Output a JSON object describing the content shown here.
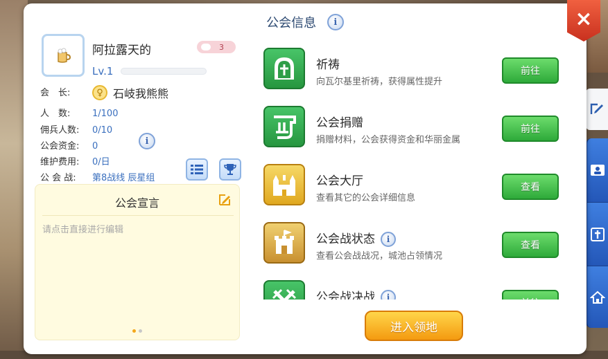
{
  "panel": {
    "title": "公会信息",
    "close_icon": "×"
  },
  "guild": {
    "name": "阿拉露天的",
    "badge_count": "3",
    "level": "Lv.1",
    "level_progress": 0.0
  },
  "info": {
    "leader_label": "会　长:",
    "leader_name": "石岐我熊熊",
    "members_label": "人　数:",
    "members_value": "1/100",
    "mercenary_label": "佣兵人数:",
    "mercenary_value": "0/10",
    "funds_label": "公会资金:",
    "funds_value": "0",
    "upkeep_label": "维护费用:",
    "upkeep_value": "0/日",
    "war_label": "公 会 战:",
    "war_value": "第8战线 辰星组"
  },
  "declaration": {
    "title": "公会宣言",
    "placeholder": "请点击直接进行编辑",
    "page_dots": 2,
    "active_dot": 0
  },
  "items": [
    {
      "name": "祈祷",
      "desc": "向瓦尔基里祈祷，获得属性提升",
      "button": "前往",
      "icon": "prayer-icon",
      "has_info": false
    },
    {
      "name": "公会捐赠",
      "desc": "捐赠材料，公会获得资金和华丽金属",
      "button": "前往",
      "icon": "donation-icon",
      "has_info": false
    },
    {
      "name": "公会大厅",
      "desc": "查看其它的公会详细信息",
      "button": "查看",
      "icon": "castle-icon",
      "has_info": false
    },
    {
      "name": "公会战状态",
      "desc": "查看公会战战况，城池占领情况",
      "button": "查看",
      "icon": "fortress-icon",
      "has_info": true
    },
    {
      "name": "公会战决战",
      "desc": "",
      "button": "前往",
      "icon": "crossed-swords-icon",
      "has_info": true
    }
  ],
  "enter_button": "进入领地",
  "colors": {
    "accent_blue": "#3a6fbe",
    "green_button": "#2eaa3a",
    "orange_button": "#f49a10",
    "close_red": "#d8402a"
  }
}
